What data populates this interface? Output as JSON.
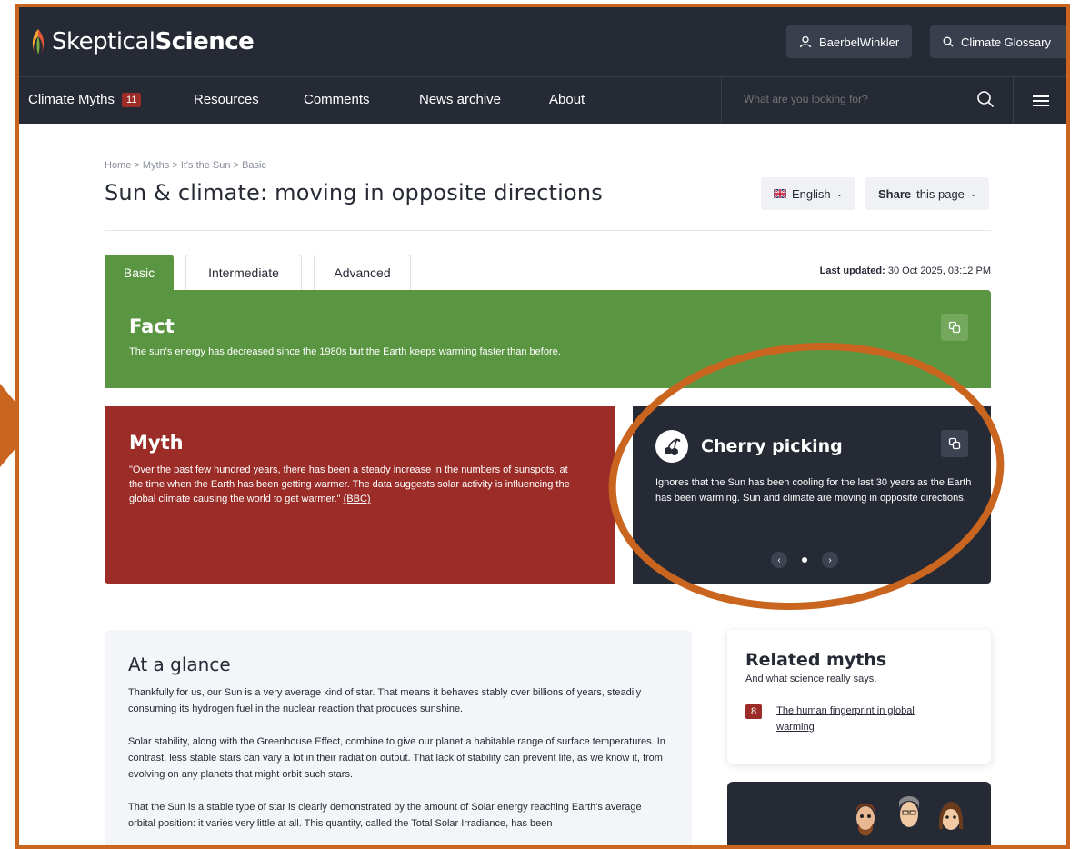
{
  "header": {
    "logo_light": "Skeptical",
    "logo_bold": "Science",
    "user_label": "BaerbelWinkler",
    "glossary_label": "Climate Glossary"
  },
  "nav": {
    "items": [
      {
        "label": "Climate Myths",
        "badge": "11"
      },
      {
        "label": "Resources"
      },
      {
        "label": "Comments"
      },
      {
        "label": "News archive"
      },
      {
        "label": "About"
      }
    ],
    "search_placeholder": "What are you looking for?"
  },
  "breadcrumb": {
    "items": [
      "Home",
      "Myths",
      "It's the Sun",
      "Basic"
    ],
    "separator": ">"
  },
  "page": {
    "title": "Sun & climate: moving in opposite directions",
    "language": "English",
    "share_bold": "Share",
    "share_rest": "this page"
  },
  "tabs": [
    {
      "label": "Basic",
      "active": true
    },
    {
      "label": "Intermediate",
      "active": false
    },
    {
      "label": "Advanced",
      "active": false
    }
  ],
  "last_updated": {
    "label": "Last updated:",
    "value": "30 Oct 2025, 03:12 PM"
  },
  "fact": {
    "heading": "Fact",
    "text": "The sun's energy has decreased since the 1980s but the Earth keeps warming faster than before."
  },
  "myth": {
    "heading": "Myth",
    "text": "\"Over the past few hundred years, there has been a steady increase in the numbers of sunspots, at the time when the Earth has been getting warmer. The data suggests solar activity is influencing the global climate causing the world to get warmer.\"",
    "source_link": "(BBC)"
  },
  "fallacy": {
    "heading": "Cherry picking",
    "icon": "cherry-icon",
    "text": "Ignores that the Sun has been cooling for the last 30 years as the Earth has been warming. Sun and climate are moving in opposite directions."
  },
  "glance": {
    "heading": "At a glance",
    "paragraphs": [
      "Thankfully for us, our Sun is a very average kind of star. That means it behaves stably over billions of years, steadily consuming its hydrogen fuel in the nuclear reaction that produces sunshine.",
      "Solar stability, along with the Greenhouse Effect, combine to give our planet a habitable range of surface temperatures. In contrast, less stable stars can vary a lot in their radiation output. That lack of stability can prevent life, as we know it, from evolving on any planets that might orbit such stars.",
      "That the Sun is a stable type of star is clearly demonstrated by the amount of Solar energy reaching Earth's average orbital position: it varies very little at all. This quantity, called the Total Solar Irradiance, has been"
    ]
  },
  "related": {
    "heading": "Related myths",
    "subtitle": "And what science really says.",
    "items": [
      {
        "rank": "8",
        "label": "The human fingerprint in global warming"
      }
    ]
  },
  "colors": {
    "dark": "#262a35",
    "fact_green": "#5a9642",
    "myth_red": "#9b2c28",
    "annotation_orange": "#c9651f"
  }
}
